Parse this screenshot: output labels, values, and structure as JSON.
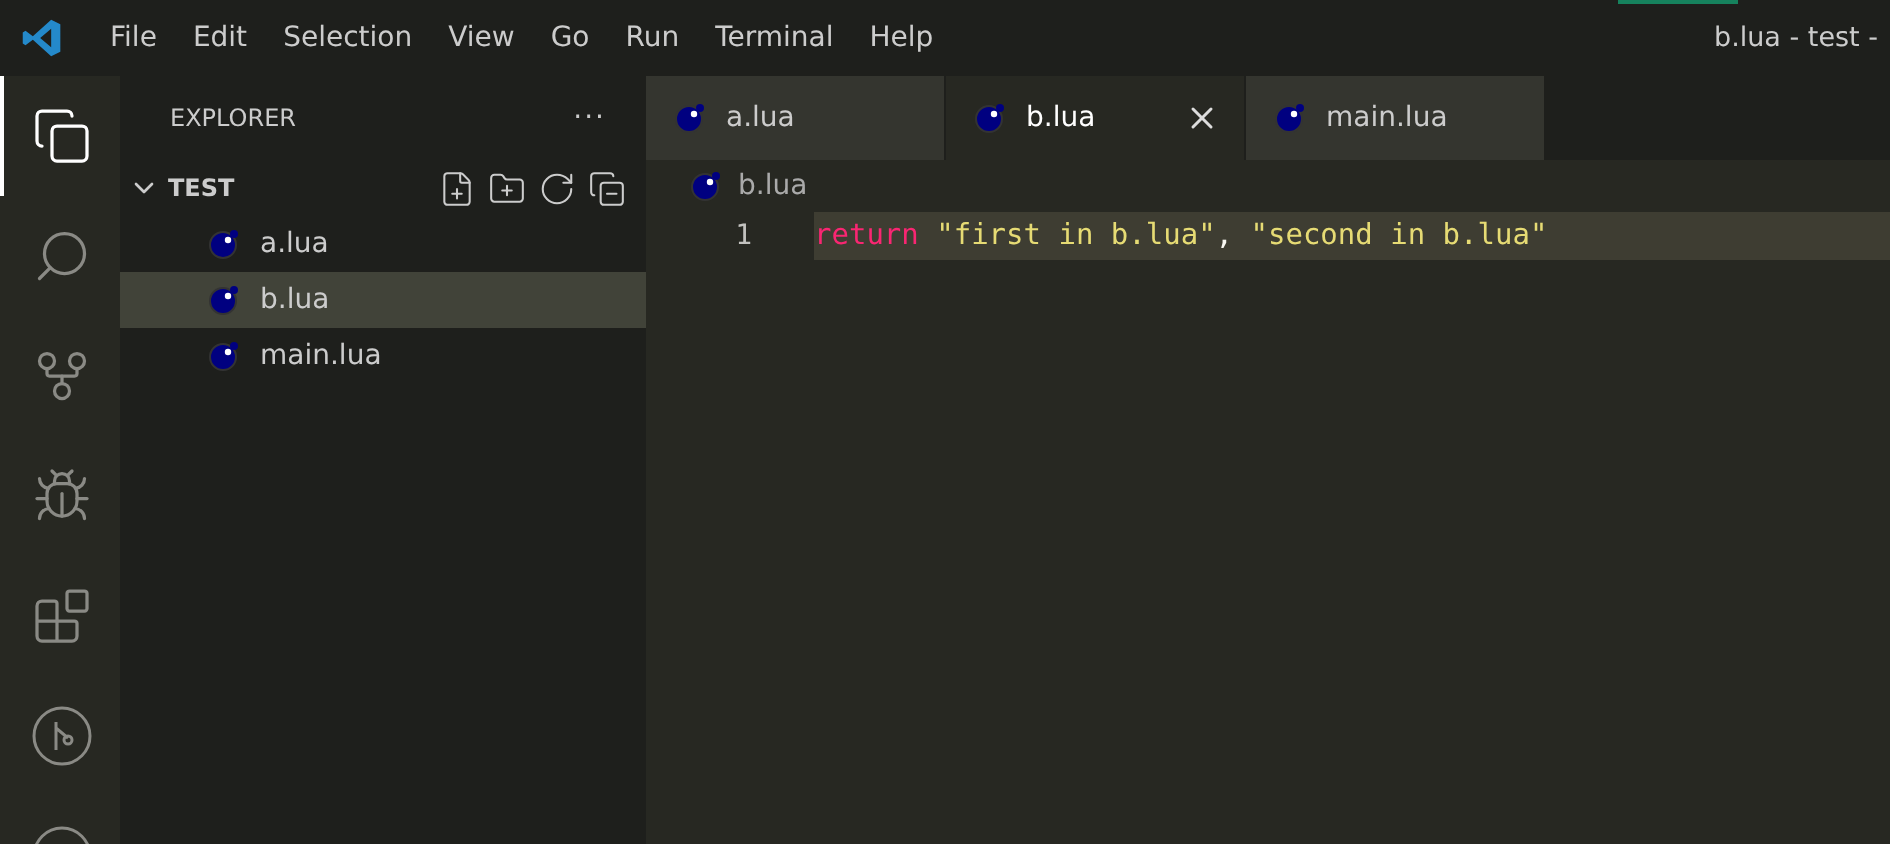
{
  "menu": [
    "File",
    "Edit",
    "Selection",
    "View",
    "Go",
    "Run",
    "Terminal",
    "Help"
  ],
  "window": {
    "title": "b.lua - test -"
  },
  "activity_bar": [
    {
      "kind": "explorer",
      "selected": true
    },
    {
      "kind": "search",
      "selected": false
    },
    {
      "kind": "source-control",
      "selected": false
    },
    {
      "kind": "debug",
      "selected": false
    },
    {
      "kind": "extensions",
      "selected": false
    },
    {
      "kind": "remote",
      "selected": false
    },
    {
      "kind": "partial",
      "selected": false
    }
  ],
  "sidebar": {
    "title": "EXPLORER",
    "more": "···",
    "folder": {
      "name": "TEST",
      "expanded": true,
      "children": [
        {
          "name": "a.lua",
          "selected": false
        },
        {
          "name": "b.lua",
          "selected": true
        },
        {
          "name": "main.lua",
          "selected": false
        }
      ]
    }
  },
  "tabs": [
    {
      "label": "a.lua",
      "selected": false
    },
    {
      "label": "b.lua",
      "selected": true
    },
    {
      "label": "main.lua",
      "selected": false
    }
  ],
  "breadcrumb": "b.lua",
  "code": [
    {
      "number": "1",
      "current": true,
      "tokens": [
        {
          "kind": "keyword",
          "text": "return"
        },
        {
          "kind": "string",
          "text": " \"first in b.lua\""
        },
        {
          "kind": "plain",
          "text": ", "
        },
        {
          "kind": "string",
          "text": "\"second in b.lua\""
        }
      ]
    }
  ]
}
